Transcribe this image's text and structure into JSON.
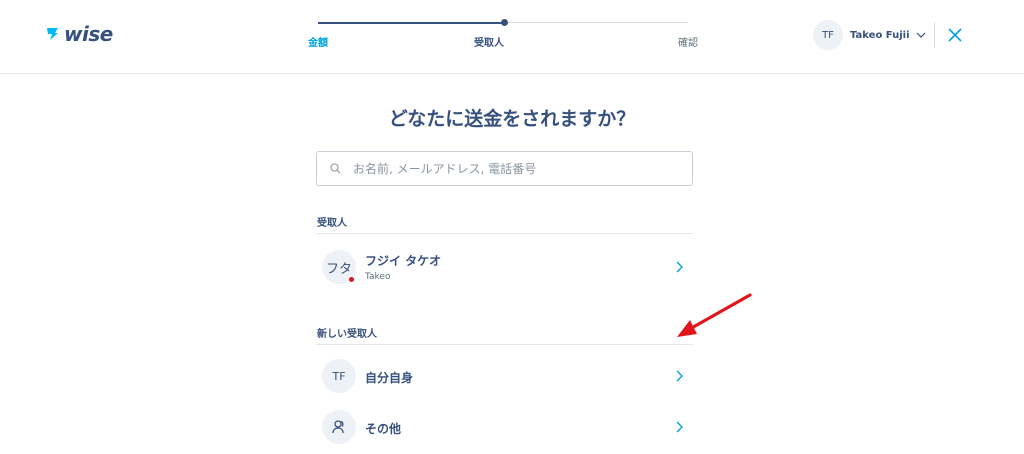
{
  "header": {
    "logo_text": "wise",
    "steps": [
      {
        "label": "金額"
      },
      {
        "label": "受取人"
      },
      {
        "label": "確認"
      }
    ],
    "user": {
      "initials": "TF",
      "name": "Takeo Fujii"
    },
    "icons": {
      "logo": "wise-flag-icon",
      "user_menu": "chevron-down-icon",
      "close": "close-icon"
    }
  },
  "main": {
    "title": "どなたに送金をされますか？",
    "search": {
      "placeholder": "お名前, メールアドレス, 電話番号",
      "value": ""
    },
    "recipients_section": {
      "label": "受取人",
      "items": [
        {
          "avatar_text": "フタ",
          "name": "フジイ タケオ",
          "sub": "Takeo",
          "has_status_dot": true
        }
      ]
    },
    "new_recipient_section": {
      "label": "新しい受取人",
      "items": [
        {
          "avatar_text": "TF",
          "name": "自分自身"
        },
        {
          "avatar_icon": "person-icon",
          "name": "その他"
        }
      ]
    }
  },
  "colors": {
    "primary": "#37517e",
    "accent": "#00a2dd",
    "annotation": "#e0161a"
  }
}
